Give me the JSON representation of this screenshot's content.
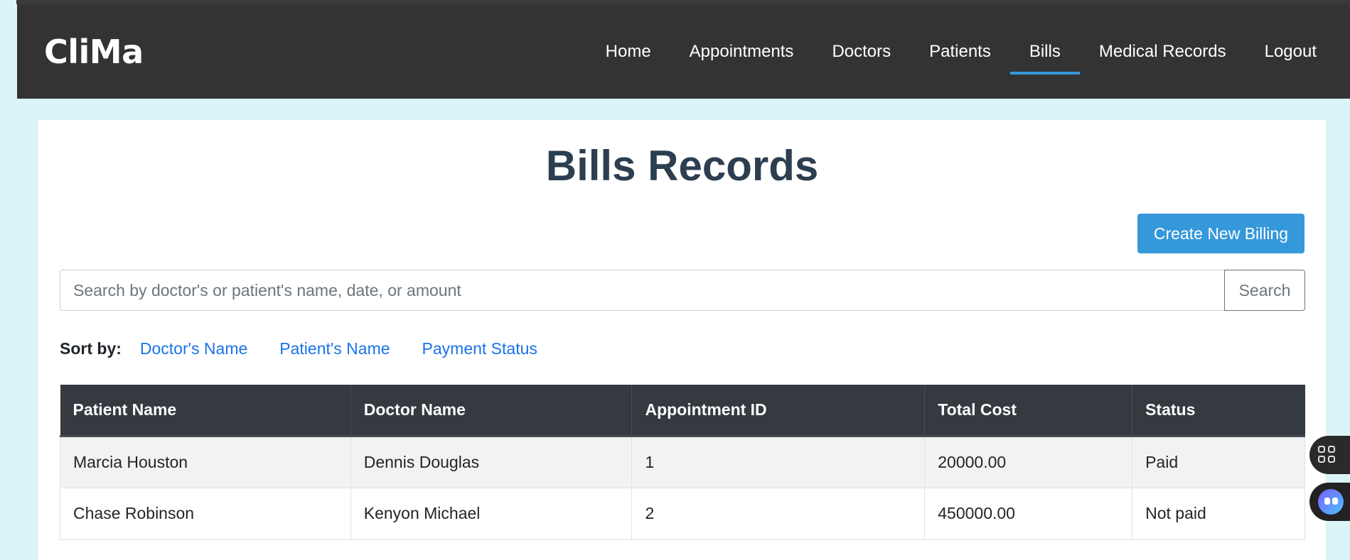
{
  "navbar": {
    "brand": "CliMa",
    "links": [
      {
        "label": "Home",
        "active": false
      },
      {
        "label": "Appointments",
        "active": false
      },
      {
        "label": "Doctors",
        "active": false
      },
      {
        "label": "Patients",
        "active": false
      },
      {
        "label": "Bills",
        "active": true
      },
      {
        "label": "Medical Records",
        "active": false
      },
      {
        "label": "Logout",
        "active": false
      }
    ],
    "accent_color": "#3498db"
  },
  "page": {
    "title": "Bills Records",
    "create_button_label": "Create New Billing"
  },
  "search": {
    "placeholder": "Search by doctor's or patient's name, date, or amount",
    "value": "",
    "button_label": "Search"
  },
  "sort": {
    "label": "Sort by:",
    "options": [
      "Doctor's Name",
      "Patient's Name",
      "Payment Status"
    ]
  },
  "table": {
    "headers": [
      "Patient Name",
      "Doctor Name",
      "Appointment ID",
      "Total Cost",
      "Status"
    ],
    "rows": [
      [
        "Marcia Houston",
        "Dennis Douglas",
        "1",
        "20000.00",
        "Paid"
      ],
      [
        "Chase Robinson",
        "Kenyon Michael",
        "2",
        "450000.00",
        "Not paid"
      ]
    ]
  },
  "floating": {
    "icons": [
      "grid-icon",
      "assistant-bot-icon"
    ]
  }
}
